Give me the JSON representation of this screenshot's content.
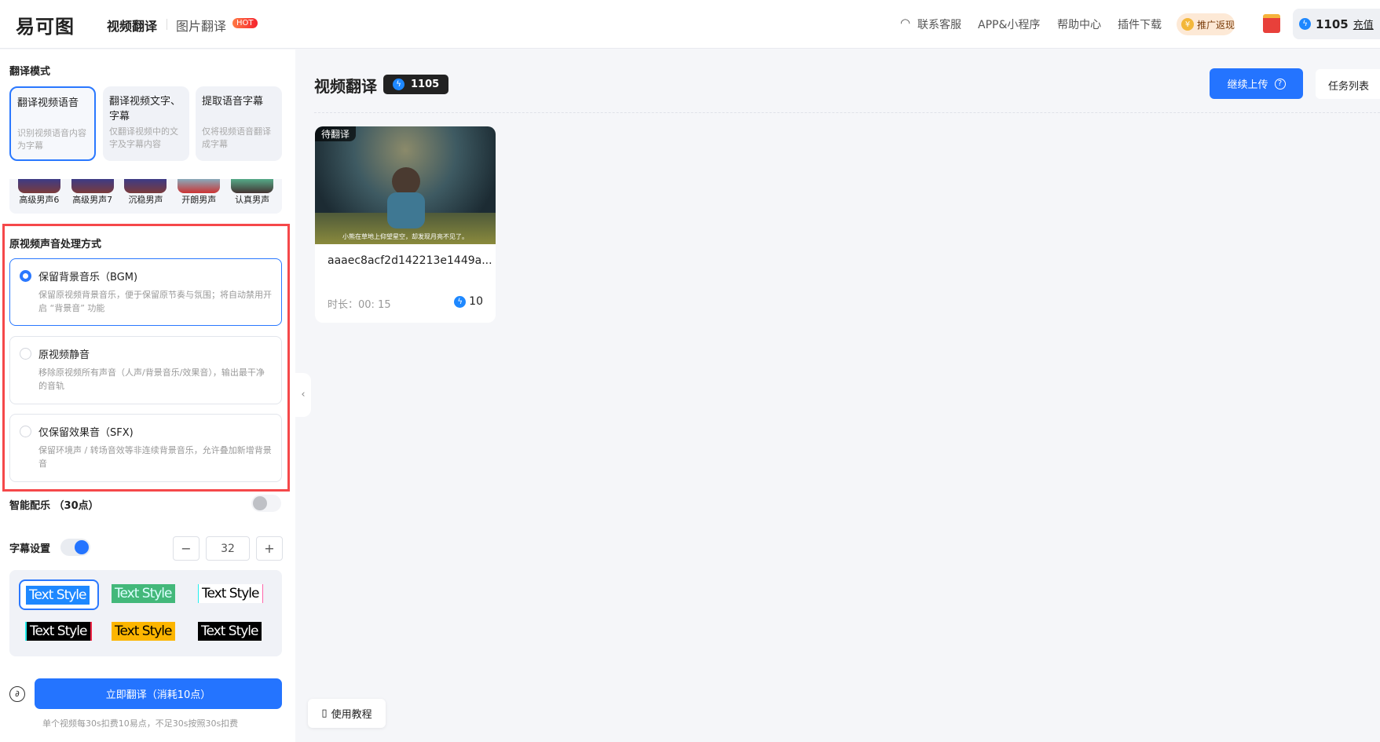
{
  "header": {
    "logo": "易可图",
    "tabs": [
      {
        "label": "视频翻译"
      },
      {
        "label": "图片翻译"
      }
    ],
    "hot_badge": "HOT",
    "links": [
      "联系客服",
      "APP&小程序",
      "帮助中心",
      "插件下载"
    ],
    "promo": "推广返现",
    "promo_coin": "¥",
    "credits": "1105",
    "recharge": "充值"
  },
  "sidebar": {
    "mode_title": "翻译模式",
    "modes": [
      {
        "title": "翻译视频语音",
        "desc": "识别视频语音内容为字幕"
      },
      {
        "title": "翻译视频文字、字幕",
        "desc": "仅翻译视频中的文字及字幕内容"
      },
      {
        "title": "提取语音字幕",
        "desc": "仅将视频语音翻译成字幕"
      }
    ],
    "voices": [
      "高级男声6",
      "高级男声7",
      "沉稳男声",
      "开朗男声",
      "认真男声"
    ],
    "audio_title": "原视频声音处理方式",
    "audio_options": [
      {
        "title": "保留背景音乐（BGM)",
        "desc": "保留原视频背景音乐，便于保留原节奏与氛围；将自动禁用开启 “背景音” 功能",
        "selected": true
      },
      {
        "title": "原视频静音",
        "desc": "移除原视频所有声音（人声/背景音乐/效果音），输出最干净的音轨",
        "selected": false
      },
      {
        "title": "仅保留效果音（SFX)",
        "desc": "保留环境声 / 转场音效等非连续背景音乐，允许叠加新增背景音",
        "selected": false
      }
    ],
    "smart_music": "智能配乐 （30点）",
    "smart_music_on": false,
    "subtitle": "字幕设置",
    "subtitle_on": true,
    "font_size": "32",
    "minus": "−",
    "plus": "+",
    "text_style": "Text Style",
    "translate_button": "立即翻译（消耗10点）",
    "hint": "单个视频每30s扣费10易点，不足30s按照30s扣费"
  },
  "main": {
    "title": "视频翻译",
    "credits": "1105",
    "upload": "继续上传",
    "upload_help": "?",
    "task_list": "任务列表",
    "card": {
      "status": "待翻译",
      "subtitle": "小熊在草地上仰望星空，却发现月亮不见了。",
      "name": "aaaec8acf2d142213e1449a...",
      "duration": "时长：00: 15",
      "cost": "10"
    },
    "tutorial": "使用教程"
  },
  "colors": {
    "accent": "#2474ff",
    "highlight": "#f5484a"
  }
}
